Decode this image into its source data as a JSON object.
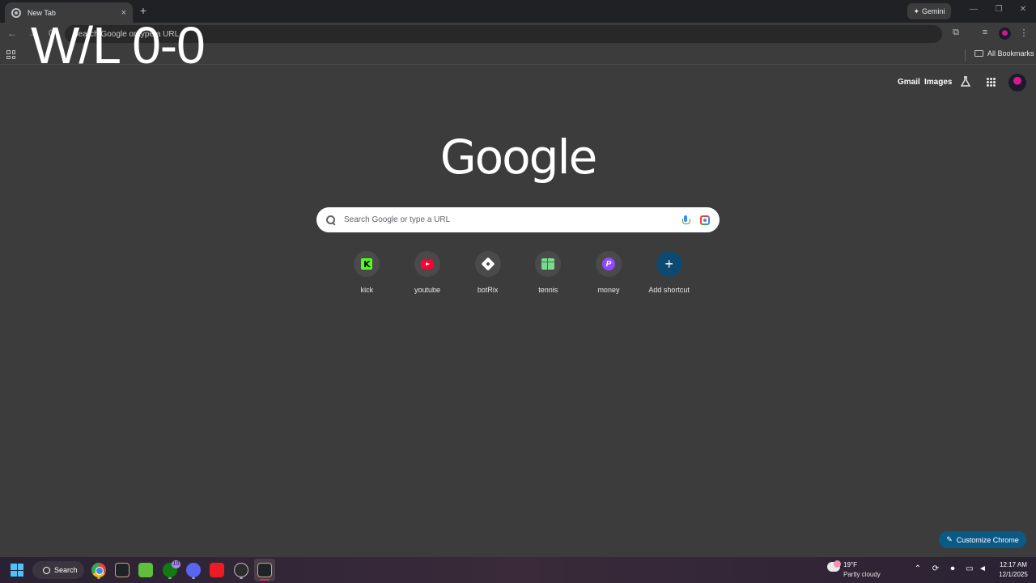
{
  "browser": {
    "tab_title": "New Tab",
    "tab_close": "×",
    "new_tab": "+",
    "gemini_label": "Gemini",
    "gemini_glyph": "✦",
    "minimize": "—",
    "restore": "❐",
    "close": "✕",
    "back": "←",
    "forward": "→",
    "reload": "C",
    "omnibox_text": "Search Google or type a URL",
    "all_bookmarks": "All Bookmarks"
  },
  "overlay": {
    "text": "W/L 0-0"
  },
  "ntp": {
    "gmail": "Gmail",
    "images": "Images",
    "logo": "Google",
    "search_placeholder": "Search Google or type a URL",
    "customize_label": "Customize Chrome",
    "customize_glyph": "✎"
  },
  "shortcuts": [
    {
      "label": "kick",
      "glyph": "K"
    },
    {
      "label": "youtube"
    },
    {
      "label": "botRix"
    },
    {
      "label": "tennis"
    },
    {
      "label": "money",
      "glyph": "P"
    },
    {
      "label": "Add shortcut",
      "glyph": "+"
    }
  ],
  "taskbar": {
    "search_label": "Search",
    "xbox_badge": "10",
    "weather_temp": "19°F",
    "weather_desc": "Partly cloudy",
    "time": "12:17 AM",
    "date": "12/1/2025",
    "tray_chevron": "⌃",
    "tray_mic": "🎤",
    "tray_volume": "🔊"
  },
  "colors": {
    "page_bg": "#3c3c3c",
    "accent": "#0b5a86",
    "kick": "#53fc18",
    "youtube": "#ff0033"
  }
}
